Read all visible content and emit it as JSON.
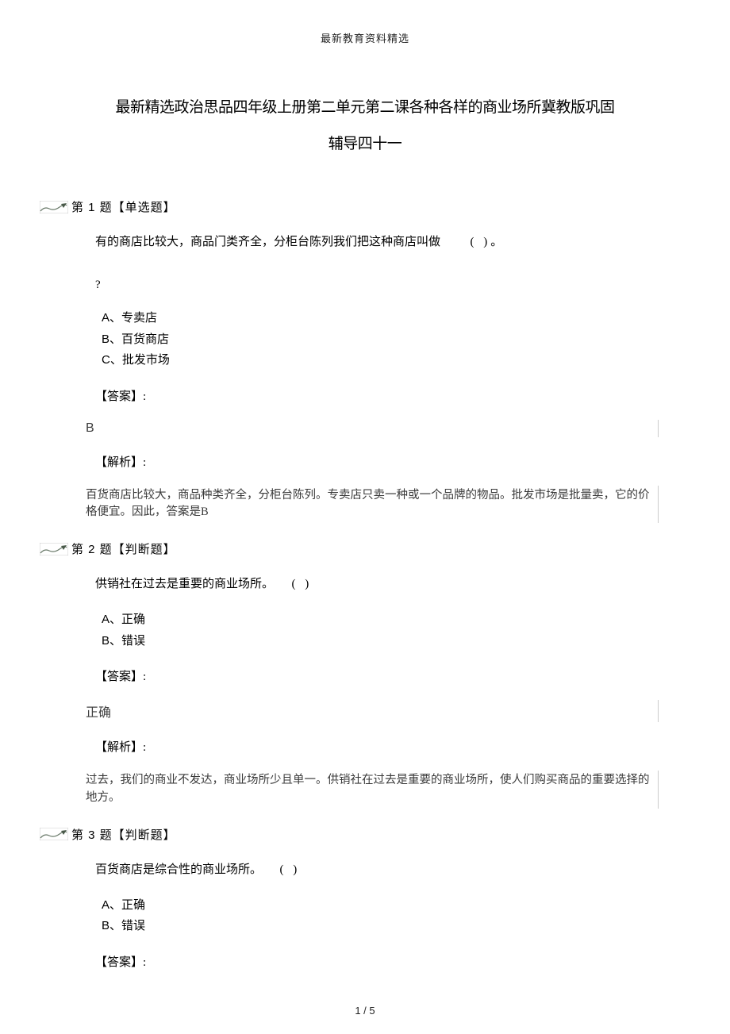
{
  "header": "最新教育资料精选",
  "title_line1": "最新精选政治思品四年级上册第二单元第二课各种各样的商业场所冀教版巩固",
  "title_line2": "辅导四十一",
  "q1": {
    "header": "第 1 题【单选题】",
    "text_prefix": "有的商店比较大，商品门类齐全，分柜台陈列我们把这种商店叫做",
    "blank": "(        )。",
    "mark": "?",
    "opt_a_letter": "A、",
    "opt_a_text": "专卖店",
    "opt_b_letter": "B、",
    "opt_b_text": "百货商店",
    "opt_c_letter": "C、",
    "opt_c_text": "批发市场",
    "answer_label": "【答案】:",
    "answer_value": "B",
    "explain_label": "【解析】:",
    "explain_text": "百货商店比较大，商品种类齐全，分柜台陈列。专卖店只卖一种或一个品牌的物品。批发市场是批量卖，它的价格便宜。因此，答案是B"
  },
  "q2": {
    "header": "第 2 题【判断题】",
    "text_prefix": "供销社在过去是重要的商业场所。",
    "blank": "(        )",
    "opt_a_letter": "A、",
    "opt_a_text": "正确",
    "opt_b_letter": "B、",
    "opt_b_text": "错误",
    "answer_label": "【答案】:",
    "answer_value": "正确",
    "explain_label": "【解析】:",
    "explain_text": "过去，我们的商业不发达，商业场所少且单一。供销社在过去是重要的商业场所，使人们购买商品的重要选择的地方。"
  },
  "q3": {
    "header": "第 3 题【判断题】",
    "text_prefix": "百货商店是综合性的商业场所。",
    "blank": "(        )",
    "opt_a_letter": "A、",
    "opt_a_text": "正确",
    "opt_b_letter": "B、",
    "opt_b_text": "错误",
    "answer_label": "【答案】:"
  },
  "footer": "1 / 5"
}
